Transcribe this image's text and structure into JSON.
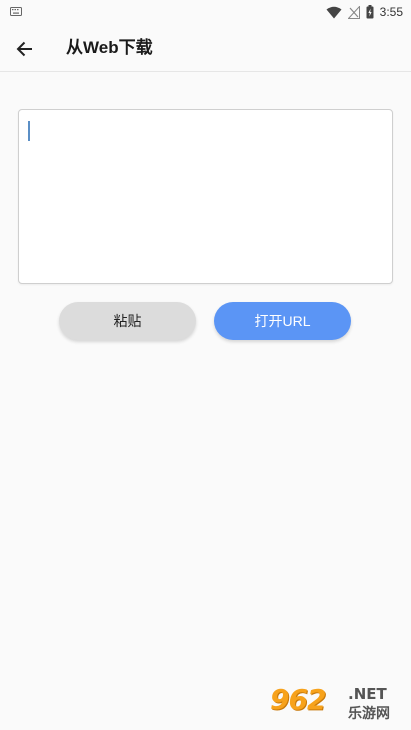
{
  "status_bar": {
    "time": "3:55",
    "icons": [
      "keyboard-icon",
      "wifi-icon",
      "no-signal-icon",
      "battery-icon"
    ]
  },
  "app_bar": {
    "title": "从Web下载",
    "back_icon": "arrow-left-icon"
  },
  "url_input": {
    "value": ""
  },
  "buttons": {
    "paste_label": "粘贴",
    "open_url_label": "打开URL"
  },
  "watermark": {
    "number": "962",
    "suffix": ".NET",
    "site_name": "乐游网"
  },
  "colors": {
    "background": "#fafafa",
    "accent": "#5b95f5",
    "paste_button": "#dcdcdc",
    "watermark_orange": "#f7a21b"
  }
}
